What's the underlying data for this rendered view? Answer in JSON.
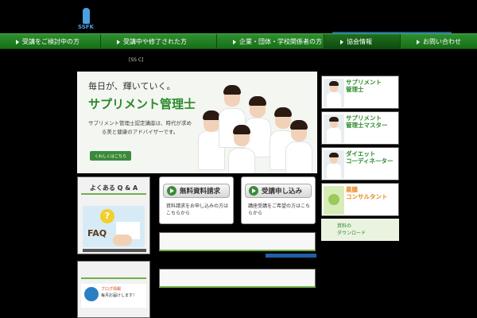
{
  "header": {
    "logo_text": "SSFK",
    "top_note": "",
    "top_links": ""
  },
  "nav": {
    "items": [
      {
        "label": "受講をご検討中の方"
      },
      {
        "label": "受講中や修了された方"
      },
      {
        "label": "企業・団体・学校関係者の方"
      },
      {
        "label": "協会情報"
      },
      {
        "label": "お問い合わせ"
      }
    ]
  },
  "breadcrumb": "[SS  C]",
  "hero": {
    "catch": "毎日が、輝いていく。",
    "title": "サプリメント管理士",
    "sub": "サプリメント管理士認定講座は、時代が求める美と健康のアドバイザーです。",
    "button": "くわしくはこちら"
  },
  "side": {
    "cards": [
      {
        "title": "サプリメント\n管理士",
        "desc": ""
      },
      {
        "title": "サプリメント\n管理士マスター",
        "desc": ""
      },
      {
        "title": "ダイエット\nコーディネーター",
        "desc": ""
      },
      {
        "title": "薬膳\nコンサルタント",
        "desc": ""
      }
    ],
    "small": "資料の\nダウンロード"
  },
  "qa": {
    "header": "よくある Q & A",
    "faq": "FAQ",
    "tag": ""
  },
  "blog": {
    "header": "",
    "line1": "ブログ情報",
    "line2": "毎月お届けします！",
    "line3": "",
    "caption": ""
  },
  "cta": {
    "request": {
      "label": "無料資料請求",
      "desc": "資料請求をお申し込みの方はこちらから"
    },
    "apply": {
      "label": "受講申し込み",
      "desc": "講座受講をご希望の方はこちらから"
    }
  },
  "info": {
    "row1": {
      "left": "",
      "right": ""
    },
    "row2": {
      "left": "",
      "right": ""
    }
  },
  "status": {
    "line1": "",
    "line2": "",
    "line3": "",
    "line4": "",
    "line5": ""
  }
}
